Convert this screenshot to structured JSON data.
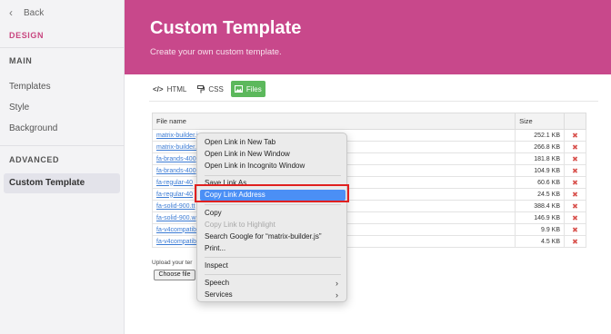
{
  "sidebar": {
    "back_label": "Back",
    "design_heading": "DESIGN",
    "main_heading": "MAIN",
    "items_main": [
      "Templates",
      "Style",
      "Background"
    ],
    "advanced_heading": "ADVANCED",
    "active_item": "Custom Template"
  },
  "header": {
    "title": "Custom Template",
    "subtitle": "Create your own custom template.",
    "color": "#c8488b"
  },
  "tabs": [
    {
      "label": "HTML",
      "icon": "code-icon"
    },
    {
      "label": "CSS",
      "icon": "paint-roller-icon"
    },
    {
      "label": "Files",
      "icon": "image-icon",
      "active": true
    }
  ],
  "files": {
    "col_name": "File name",
    "col_size": "Size",
    "rows": [
      {
        "name": "matrix-builder.js",
        "size": "252.1 KB"
      },
      {
        "name": "matrix-builder.",
        "size": "266.8 KB"
      },
      {
        "name": "fa-brands-400",
        "size": "181.8 KB"
      },
      {
        "name": "fa-brands-400",
        "size": "104.9 KB"
      },
      {
        "name": "fa-regular-40",
        "size": "60.6 KB"
      },
      {
        "name": "fa-regular-40",
        "size": "24.5 KB"
      },
      {
        "name": "fa-solid-900.tt",
        "size": "388.4 KB"
      },
      {
        "name": "fa-solid-900.w",
        "size": "146.9 KB"
      },
      {
        "name": "fa-v4compatib",
        "size": "9.9 KB"
      },
      {
        "name": "fa-v4compatib",
        "size": "4.5 KB"
      }
    ],
    "delete_glyph": "✖"
  },
  "upload": {
    "label": "Upload your ter",
    "button": "Choose file"
  },
  "context_menu": {
    "items": [
      "Open Link in New Tab",
      "Open Link in New Window",
      "Open Link in Incognito Window",
      "Save Link As...",
      "Copy Link Address",
      "Copy",
      "Copy Link to Highlight",
      "Search Google for “matrix-builder.js”",
      "Print...",
      "Inspect",
      "Speech",
      "Services"
    ],
    "highlight_color": "#4b8ff5"
  }
}
